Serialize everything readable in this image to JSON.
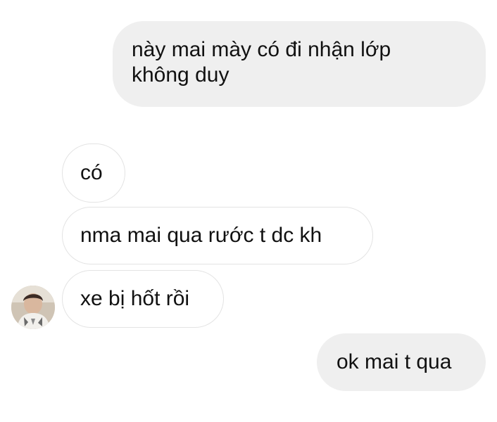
{
  "conversation": {
    "messages": [
      {
        "sender": "me",
        "lines": [
          "này mai mày có đi nhận lớp",
          "không duy"
        ]
      },
      {
        "sender": "contact",
        "text": "có"
      },
      {
        "sender": "contact",
        "text": "nma mai qua rước t dc kh"
      },
      {
        "sender": "contact",
        "text": "xe bị hốt rồi"
      },
      {
        "sender": "me",
        "text": "ok mai t qua"
      }
    ]
  },
  "colors": {
    "page_background": "#ffffff",
    "outgoing_bubble": "#efefef",
    "incoming_bubble": "#ffffff",
    "incoming_border": "#e3e3e3",
    "text": "#111111"
  },
  "icons": {
    "contact_avatar": "contact-avatar-photo"
  }
}
